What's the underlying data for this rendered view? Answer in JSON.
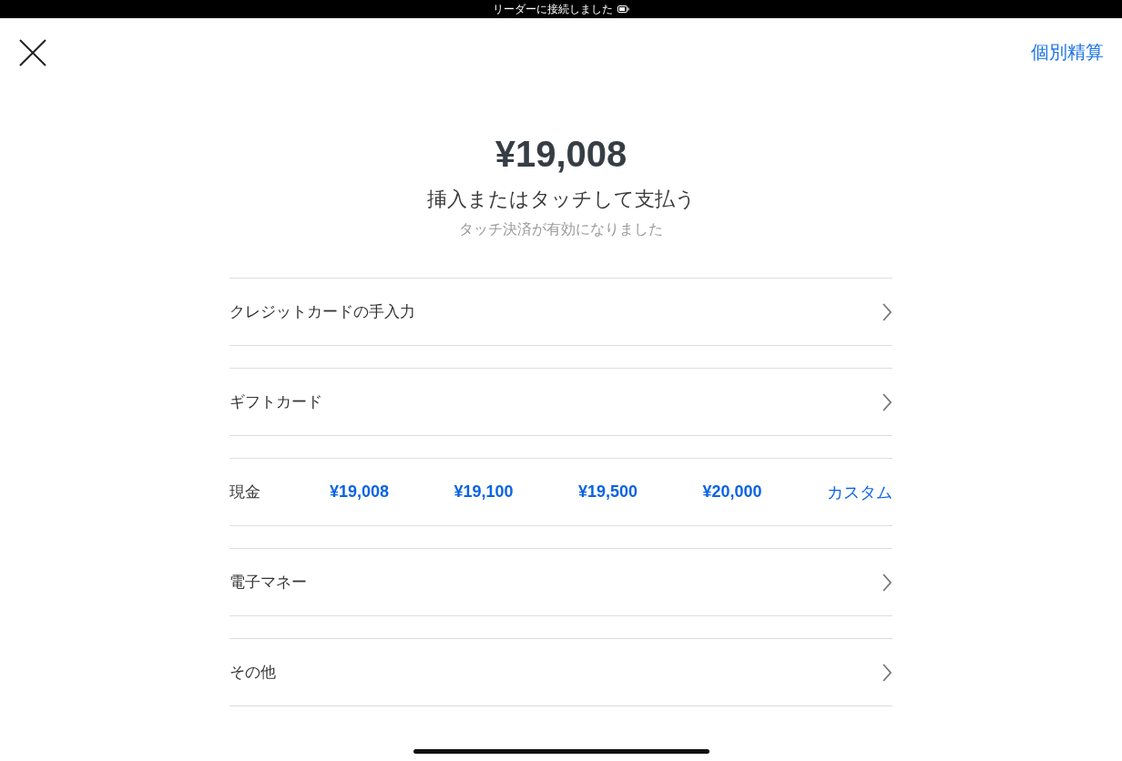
{
  "status_bar": {
    "text": "リーダーに接続しました"
  },
  "header": {
    "action": "個別精算"
  },
  "amount": "¥19,008",
  "prompt": "挿入またはタッチして支払う",
  "note": "タッチ決済が有効になりました",
  "options": [
    {
      "kind": "nav",
      "label": "クレジットカードの手入力"
    },
    {
      "kind": "nav",
      "label": "ギフトカード"
    },
    {
      "kind": "cash",
      "label": "現金",
      "amounts": [
        "¥19,008",
        "¥19,100",
        "¥19,500",
        "¥20,000"
      ],
      "custom": "カスタム"
    },
    {
      "kind": "nav",
      "label": "電子マネー"
    },
    {
      "kind": "nav",
      "label": "その他"
    }
  ]
}
